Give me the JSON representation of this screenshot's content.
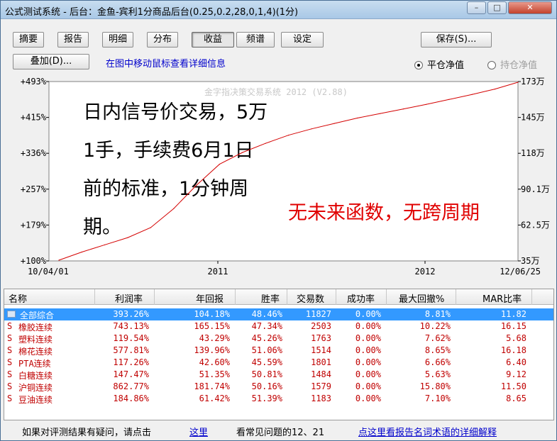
{
  "window": {
    "title": "公式测试系统 - 后台：金鱼-宾利1分商品后台(0.25,0.2,28,0,1,4)(1分)",
    "minimize_glyph": "–",
    "maximize_glyph": "□",
    "close_glyph": "✕"
  },
  "toolbar": {
    "tabs": [
      "摘要",
      "报告",
      "明细",
      "分布",
      "收益",
      "频谱",
      "设定"
    ],
    "save_label": "保存(S)...",
    "overlay_label": "叠加(D)..."
  },
  "hint_text": "在图中移动鼠标查看详细信息",
  "radios": [
    {
      "label": "平仓净值",
      "checked": true,
      "disabled": false
    },
    {
      "label": "持仓净值",
      "checked": false,
      "disabled": true
    }
  ],
  "chart_data": {
    "type": "line",
    "watermark": "金字指决策交易系统 2012 (V2.88)",
    "left_ticks": [
      "+493%",
      "+415%",
      "+336%",
      "+257%",
      "+179%",
      "+100%"
    ],
    "right_ticks": [
      "173万",
      "145万",
      "118万",
      "90.1万",
      "62.5万",
      "35万"
    ],
    "x_ticks": [
      "10/04/01",
      "2011",
      "2012",
      "12/06/25"
    ],
    "ylim": [
      100,
      493
    ],
    "series": [
      {
        "color": "#d40000",
        "x": [
          0,
          5,
          10,
          15,
          20,
          25,
          30,
          35,
          40,
          45,
          50,
          55,
          60,
          65,
          70,
          75,
          80,
          85,
          90,
          95,
          100
        ],
        "values": [
          100,
          118,
          134,
          150,
          172,
          214,
          266,
          312,
          338,
          358,
          376,
          390,
          402,
          414,
          424,
          434,
          444,
          455,
          466,
          478,
          493
        ]
      }
    ],
    "annotation_main": [
      "日内信号价交易，5万",
      "1手，手续费6月1日",
      "前的标准，1分钟周",
      "期。"
    ],
    "annotation_red": "无未来函数，无跨周期"
  },
  "table": {
    "headers": [
      "名称",
      "利润率",
      "年回报",
      "胜率",
      "交易数",
      "成功率",
      "最大回撤%",
      "MAR比率"
    ],
    "rows": [
      {
        "prefix": "",
        "name": "全部综合",
        "profit": "393.26%",
        "annual": "104.18%",
        "win": "48.46%",
        "trades": "11827",
        "success": "0.00%",
        "drawdown": "8.81%",
        "mar": "11.82"
      },
      {
        "prefix": "S",
        "name": "橡胶连续",
        "profit": "743.13%",
        "annual": "165.15%",
        "win": "47.34%",
        "trades": "2503",
        "success": "0.00%",
        "drawdown": "10.22%",
        "mar": "16.15"
      },
      {
        "prefix": "S",
        "name": "塑料连续",
        "profit": "119.54%",
        "annual": "43.29%",
        "win": "45.26%",
        "trades": "1763",
        "success": "0.00%",
        "drawdown": "7.62%",
        "mar": "5.68"
      },
      {
        "prefix": "S",
        "name": "棉花连续",
        "profit": "577.81%",
        "annual": "139.96%",
        "win": "51.06%",
        "trades": "1514",
        "success": "0.00%",
        "drawdown": "8.65%",
        "mar": "16.18"
      },
      {
        "prefix": "S",
        "name": "PTA连续",
        "profit": "117.26%",
        "annual": "42.60%",
        "win": "45.59%",
        "trades": "1801",
        "success": "0.00%",
        "drawdown": "6.66%",
        "mar": "6.40"
      },
      {
        "prefix": "S",
        "name": "白糖连续",
        "profit": "147.47%",
        "annual": "51.35%",
        "win": "50.81%",
        "trades": "1484",
        "success": "0.00%",
        "drawdown": "5.63%",
        "mar": "9.12"
      },
      {
        "prefix": "S",
        "name": "沪铜连续",
        "profit": "862.77%",
        "annual": "181.74%",
        "win": "50.16%",
        "trades": "1579",
        "success": "0.00%",
        "drawdown": "15.80%",
        "mar": "11.50"
      },
      {
        "prefix": "S",
        "name": "豆油连续",
        "profit": "184.86%",
        "annual": "61.42%",
        "win": "51.39%",
        "trades": "1183",
        "success": "0.00%",
        "drawdown": "7.10%",
        "mar": "8.65"
      }
    ]
  },
  "status": {
    "question_text": "如果对评测结果有疑问，请点击",
    "here_link": "这里",
    "faq_text": "看常见问题的12、21",
    "glossary_link": "点这里看报告名词术语的详细解释"
  }
}
